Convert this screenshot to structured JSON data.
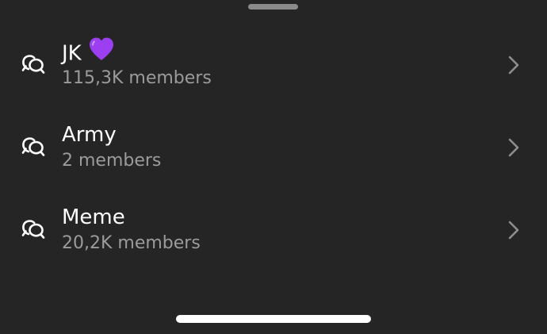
{
  "sheet": {
    "grabber_label": ""
  },
  "channels": [
    {
      "name": "JK",
      "emoji": "purple-heart",
      "members": "115,3K members"
    },
    {
      "name": "Army",
      "members": "2 members"
    },
    {
      "name": "Meme",
      "members": "20,2K members"
    }
  ],
  "icons": {
    "row": "broadcast-chat-icon",
    "chevron": "chevron-right-icon",
    "emoji": "purple-heart-icon"
  },
  "colors": {
    "background": "#252525",
    "title": "#ffffff",
    "subtitle": "#9b9b9b",
    "chevron": "#8e8e8e",
    "heart": "#9b3ff0"
  }
}
